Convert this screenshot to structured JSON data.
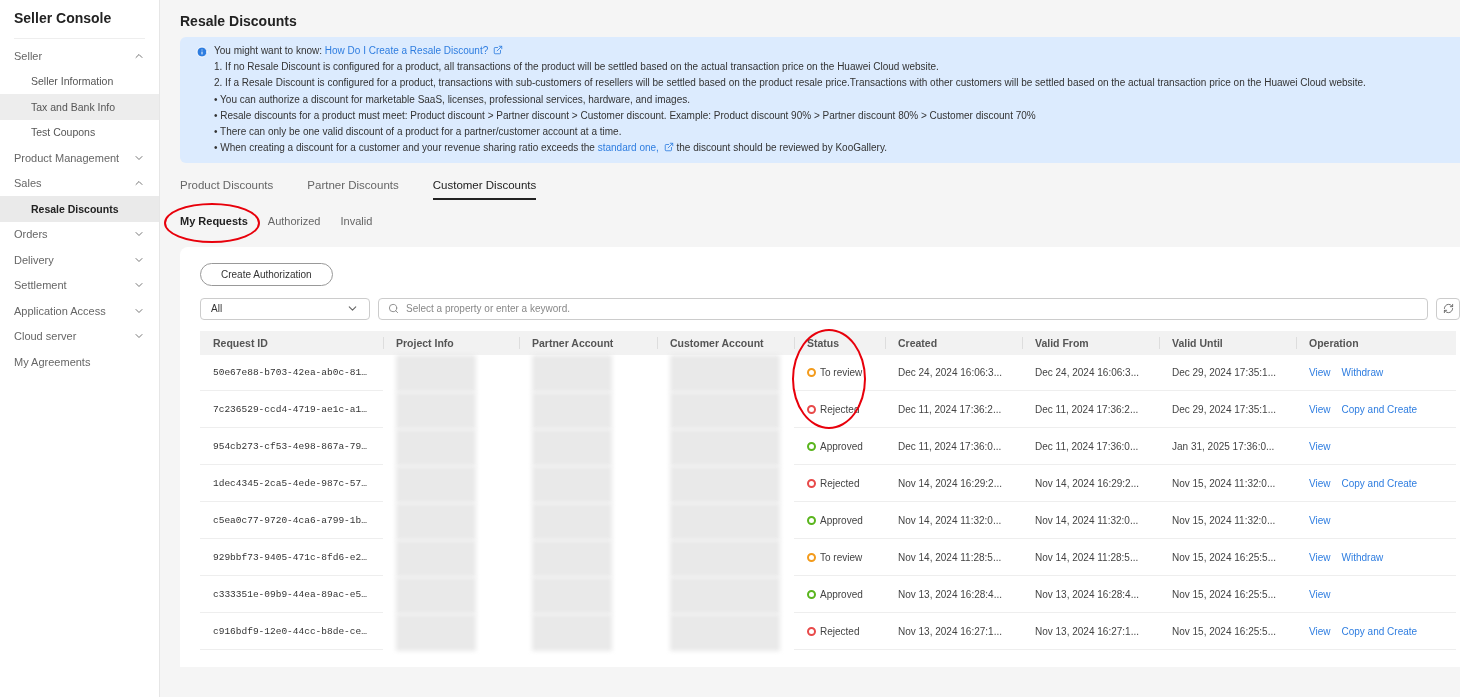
{
  "sidebar": {
    "title": "Seller Console",
    "items": [
      {
        "kind": "group",
        "label": "Seller",
        "expanded": true,
        "children": [
          {
            "label": "Seller Information",
            "selected": false,
            "hovered": false
          },
          {
            "label": "Tax and Bank Info",
            "selected": false,
            "hovered": true
          },
          {
            "label": "Test Coupons",
            "selected": false,
            "hovered": false
          }
        ]
      },
      {
        "kind": "group",
        "label": "Product Management",
        "expanded": false
      },
      {
        "kind": "group",
        "label": "Sales",
        "expanded": true,
        "children": [
          {
            "label": "Resale Discounts",
            "selected": true,
            "hovered": false
          }
        ]
      },
      {
        "kind": "group",
        "label": "Orders",
        "expanded": false
      },
      {
        "kind": "group",
        "label": "Delivery",
        "expanded": false
      },
      {
        "kind": "group",
        "label": "Settlement",
        "expanded": false
      },
      {
        "kind": "group",
        "label": "Application Access",
        "expanded": false
      },
      {
        "kind": "group",
        "label": "Cloud server",
        "expanded": false
      },
      {
        "kind": "link",
        "label": "My Agreements"
      }
    ]
  },
  "page_title": "Resale Discounts",
  "info": {
    "lines": [
      {
        "kind": "link",
        "before": "You might want to know:",
        "link": "How Do I Create a Resale Discount?"
      },
      {
        "kind": "text",
        "text": "1. If no Resale Discount is configured for a product, all transactions of the product will be settled based on the actual transaction price on the Huawei Cloud website."
      },
      {
        "kind": "text",
        "text": "2. If a Resale Discount is configured for a product, transactions with sub-customers of resellers will be settled based on the product resale price.Transactions with other customers will be settled based on the actual transaction price on the Huawei Cloud website."
      },
      {
        "kind": "text",
        "text": "• You can authorize a discount for marketable SaaS, licenses, professional services, hardware, and images."
      },
      {
        "kind": "text",
        "text": "• Resale discounts for a product must meet: Product discount > Partner discount > Customer discount. Example: Product discount 90% > Partner discount 80% > Customer discount 70%"
      },
      {
        "kind": "text",
        "text": "• There can only be one valid discount of a product for a partner/customer account at a time."
      },
      {
        "kind": "link",
        "before": "• When creating a discount for a customer and your revenue sharing ratio exceeds the",
        "link": "standard one,",
        "after": "the discount should be reviewed by KooGallery."
      }
    ]
  },
  "tabs": [
    {
      "label": "Product Discounts",
      "selected": false
    },
    {
      "label": "Partner Discounts",
      "selected": false
    },
    {
      "label": "Customer Discounts",
      "selected": true
    }
  ],
  "sub_tabs": [
    {
      "label": "My Requests",
      "selected": true,
      "circled": true
    },
    {
      "label": "Authorized",
      "selected": false,
      "circled": false
    },
    {
      "label": "Invalid",
      "selected": false,
      "circled": false
    }
  ],
  "create_button": "Create Authorization",
  "filter": {
    "value": "All"
  },
  "search": {
    "placeholder": "Select a property or enter a keyword."
  },
  "table": {
    "status_circled": true,
    "columns": [
      {
        "label": "Request ID",
        "redacted": false
      },
      {
        "label": "Project Info",
        "redacted": true
      },
      {
        "label": "Partner Account",
        "redacted": true
      },
      {
        "label": "Customer Account",
        "redacted": true
      },
      {
        "label": "Status",
        "redacted": false
      },
      {
        "label": "Created",
        "redacted": false
      },
      {
        "label": "Valid From",
        "redacted": false
      },
      {
        "label": "Valid Until",
        "redacted": false
      },
      {
        "label": "Operation",
        "redacted": false
      }
    ],
    "rows": [
      {
        "request_id": "50e67e88-b703-42ea-ab0c-81…",
        "status": "To review",
        "color": "#f39b1c",
        "created": "Dec 24, 2024 16:06:3...",
        "valid_from": "Dec 24, 2024 16:06:3...",
        "valid_until": "Dec 29, 2024 17:35:1...",
        "actions": [
          "View",
          "Withdraw"
        ]
      },
      {
        "request_id": "7c236529-ccd4-4719-ae1c-a1…",
        "status": "Rejected",
        "color": "#e84a4a",
        "created": "Dec 11, 2024 17:36:2...",
        "valid_from": "Dec 11, 2024 17:36:2...",
        "valid_until": "Dec 29, 2024 17:35:1...",
        "actions": [
          "View",
          "Copy and Create"
        ]
      },
      {
        "request_id": "954cb273-cf53-4e98-867a-79…",
        "status": "Approved",
        "color": "#5ab51e",
        "created": "Dec 11, 2024 17:36:0...",
        "valid_from": "Dec 11, 2024 17:36:0...",
        "valid_until": "Jan 31, 2025 17:36:0...",
        "actions": [
          "View"
        ]
      },
      {
        "request_id": "1dec4345-2ca5-4ede-987c-57…",
        "status": "Rejected",
        "color": "#e84a4a",
        "created": "Nov 14, 2024 16:29:2...",
        "valid_from": "Nov 14, 2024 16:29:2...",
        "valid_until": "Nov 15, 2024 11:32:0...",
        "actions": [
          "View",
          "Copy and Create"
        ]
      },
      {
        "request_id": "c5ea0c77-9720-4ca6-a799-1b…",
        "status": "Approved",
        "color": "#5ab51e",
        "created": "Nov 14, 2024 11:32:0...",
        "valid_from": "Nov 14, 2024 11:32:0...",
        "valid_until": "Nov 15, 2024 11:32:0...",
        "actions": [
          "View"
        ]
      },
      {
        "request_id": "929bbf73-9405-471c-8fd6-e2…",
        "status": "To review",
        "color": "#f39b1c",
        "created": "Nov 14, 2024 11:28:5...",
        "valid_from": "Nov 14, 2024 11:28:5...",
        "valid_until": "Nov 15, 2024 16:25:5...",
        "actions": [
          "View",
          "Withdraw"
        ]
      },
      {
        "request_id": "c333351e-09b9-44ea-89ac-e5…",
        "status": "Approved",
        "color": "#5ab51e",
        "created": "Nov 13, 2024 16:28:4...",
        "valid_from": "Nov 13, 2024 16:28:4...",
        "valid_until": "Nov 15, 2024 16:25:5...",
        "actions": [
          "View"
        ]
      },
      {
        "request_id": "c916bdf9-12e0-44cc-b8de-ce…",
        "status": "Rejected",
        "color": "#e84a4a",
        "created": "Nov 13, 2024 16:27:1...",
        "valid_from": "Nov 13, 2024 16:27:1...",
        "valid_until": "Nov 15, 2024 16:25:5...",
        "actions": [
          "View",
          "Copy and Create"
        ]
      }
    ]
  }
}
